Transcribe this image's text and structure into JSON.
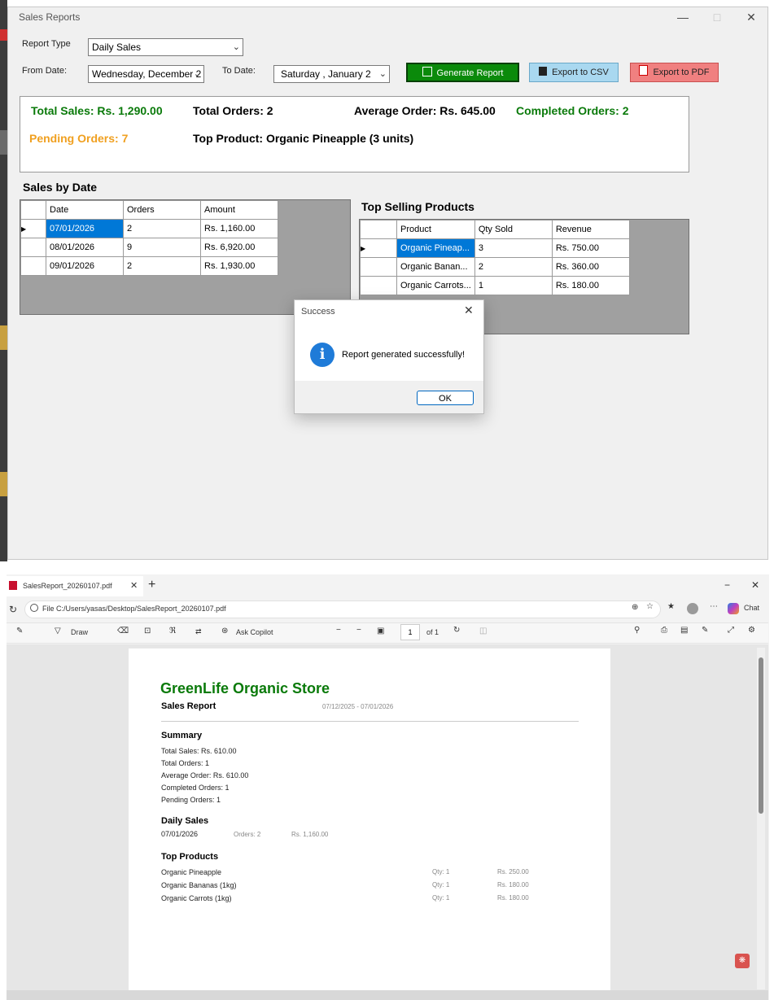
{
  "window": {
    "title": "Sales Reports",
    "report_type_label": "Report Type",
    "report_type_value": "Daily Sales",
    "from_label": "From Date:",
    "from_value": "Wednesday, December 2",
    "to_label": "To Date:",
    "to_value": "Saturday  ,   January   2",
    "generate_label": "Generate Report",
    "csv_label": "Export to CSV",
    "pdf_label": "Export to PDF",
    "colors": {
      "generate": "#0b8a0b",
      "csv": "#a9d8f0",
      "pdf": "#f08080",
      "green_text": "#0a7a0a",
      "orange_text": "#f0a020",
      "selection": "#0078d7"
    }
  },
  "summary": {
    "total_sales": "Total Sales: Rs. 1,290.00",
    "total_orders": "Total Orders: 2",
    "average_order": "Average Order: Rs. 645.00",
    "completed_orders": "Completed Orders: 2",
    "pending_orders": "Pending Orders: 7",
    "top_product": "Top Product: Organic Pineapple (3 units)"
  },
  "sales_by_date": {
    "heading": "Sales by Date",
    "columns": [
      "Date",
      "Orders",
      "Amount"
    ],
    "rows": [
      [
        "07/01/2026",
        "2",
        "Rs. 1,160.00"
      ],
      [
        "08/01/2026",
        "9",
        "Rs. 6,920.00"
      ],
      [
        "09/01/2026",
        "2",
        "Rs. 1,930.00"
      ]
    ]
  },
  "top_products": {
    "heading": "Top Selling Products",
    "columns": [
      "Product",
      "Qty Sold",
      "Revenue"
    ],
    "rows": [
      [
        "Organic Pineap...",
        "3",
        "Rs. 750.00"
      ],
      [
        "Organic Banan...",
        "2",
        "Rs. 360.00"
      ],
      [
        "Organic Carrots...",
        "1",
        "Rs. 180.00"
      ]
    ]
  },
  "dialog": {
    "title": "Success",
    "message": "Report generated successfully!",
    "ok": "OK"
  },
  "browser": {
    "tab_title": "SalesReport_20260107.pdf",
    "address": "File   C:/Users/yasas/Desktop/SalesReport_20260107.pdf",
    "chat": "Chat",
    "draw": "Draw",
    "ask_copilot": "Ask Copilot",
    "page_num": "1",
    "page_of": "of 1"
  },
  "pdf": {
    "store": "GreenLife Organic Store",
    "report_title": "Sales Report",
    "date_range": "07/12/2025 - 07/01/2026",
    "summary_heading": "Summary",
    "summary_lines": [
      "Total Sales: Rs. 610.00",
      "Total Orders: 1",
      "Average Order: Rs. 610.00",
      "Completed Orders: 1",
      "Pending Orders: 1"
    ],
    "daily_heading": "Daily Sales",
    "daily_row": [
      "07/01/2026",
      "Orders: 2",
      "Rs. 1,160.00"
    ],
    "top_heading": "Top Products",
    "top_rows": [
      [
        "Organic Pineapple",
        "Qty: 1",
        "Rs. 250.00"
      ],
      [
        "Organic Bananas (1kg)",
        "Qty: 1",
        "Rs. 180.00"
      ],
      [
        "Organic Carrots (1kg)",
        "Qty: 1",
        "Rs. 180.00"
      ]
    ]
  }
}
